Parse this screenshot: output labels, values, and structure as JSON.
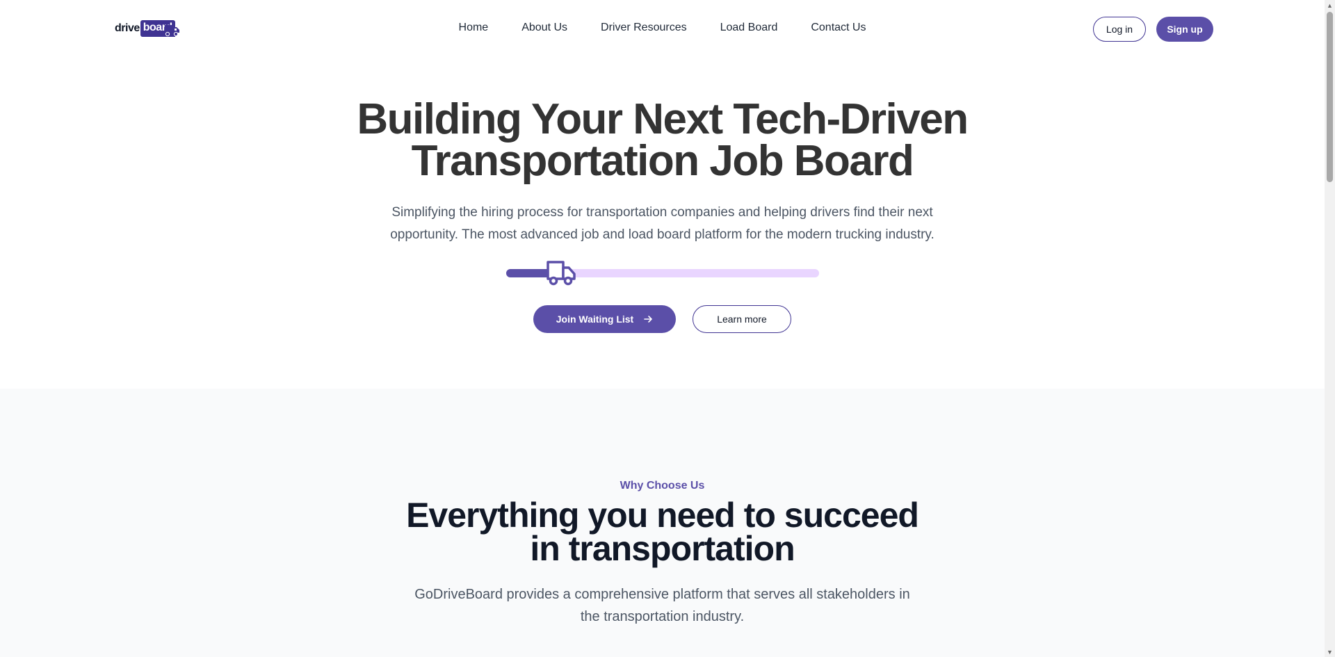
{
  "header": {
    "logo_drive": "drive",
    "logo_board": "board",
    "nav": [
      {
        "label": "Home"
      },
      {
        "label": "About Us"
      },
      {
        "label": "Driver Resources"
      },
      {
        "label": "Load Board"
      },
      {
        "label": "Contact Us"
      }
    ],
    "login_label": "Log in",
    "signup_label": "Sign up"
  },
  "hero": {
    "title_line1": "Building Your Next Tech-Driven",
    "title_line2": "Transportation Job Board",
    "subtitle_line1": "Simplifying the hiring process for transportation companies and helping drivers find their next",
    "subtitle_line2": "opportunity. The most advanced job and load board platform for the modern trucking industry.",
    "progress_fraction": 0.12,
    "join_label": "Join Waiting List",
    "learn_label": "Learn more"
  },
  "features": {
    "eyebrow": "Why Choose Us",
    "title_line1": "Everything you need to succeed",
    "title_line2": "in transportation",
    "subtitle_line1": "GoDriveBoard provides a comprehensive platform that serves all stakeholders in",
    "subtitle_line2": "the transportation industry."
  },
  "colors": {
    "brand": "#5b4fa8",
    "brand_dark": "#3f3392",
    "track": "#e9d5ff"
  },
  "icons": {
    "logo": "truck-icon",
    "progress": "truck-icon",
    "join": "arrow-right-icon"
  }
}
